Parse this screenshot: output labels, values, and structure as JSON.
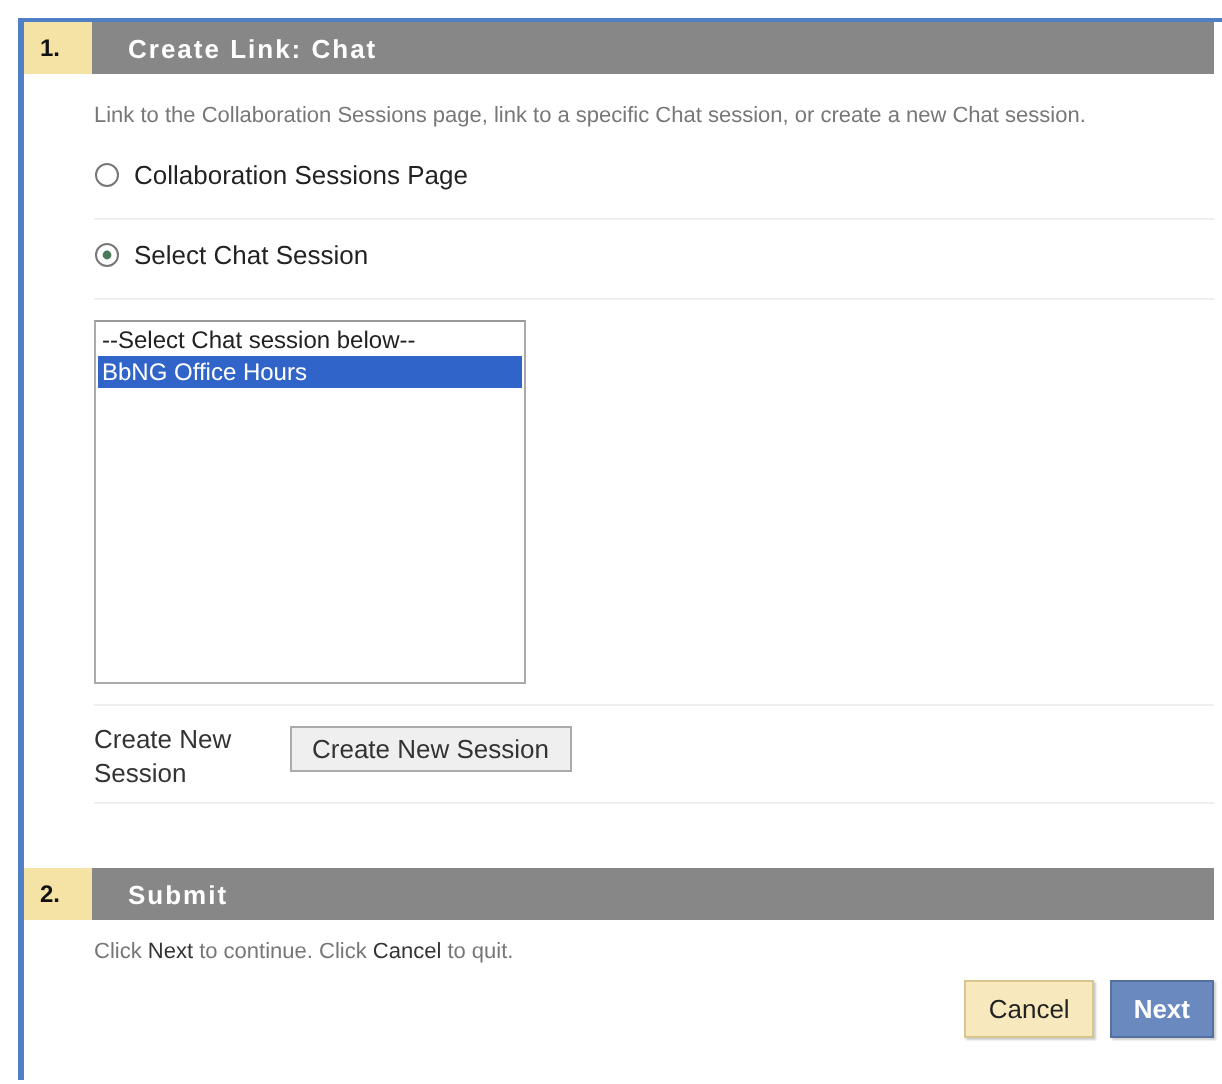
{
  "steps": [
    {
      "number": "1.",
      "title": "Create Link: Chat",
      "description": "Link to the Collaboration Sessions page, link to a specific Chat session, or create a new Chat session.",
      "options": [
        {
          "label": "Collaboration Sessions Page",
          "selected": false
        },
        {
          "label": "Select Chat Session",
          "selected": true
        }
      ],
      "session_list": {
        "items": [
          {
            "label": "--Select Chat session below--",
            "selected": false
          },
          {
            "label": "BbNG Office Hours",
            "selected": true
          }
        ]
      },
      "create_new": {
        "label": "Create New Session",
        "button": "Create New Session"
      }
    },
    {
      "number": "2.",
      "title": "Submit",
      "instructions": "Click **Next** to continue. Click **Cancel** to quit.",
      "buttons": [
        {
          "label": "Cancel",
          "kind": "secondary"
        },
        {
          "label": "Next",
          "kind": "primary"
        }
      ]
    }
  ]
}
